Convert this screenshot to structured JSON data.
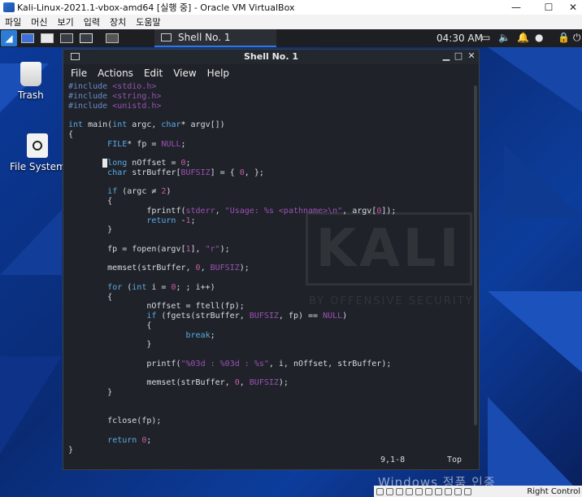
{
  "host": {
    "title": "Kali-Linux-2021.1-vbox-amd64 [실행 중] - Oracle VM VirtualBox",
    "menu": [
      "파일",
      "머신",
      "보기",
      "입력",
      "장치",
      "도움말"
    ],
    "status_right": "Right Control"
  },
  "panel": {
    "task_label": "Shell No. 1",
    "clock": "04:30 AM"
  },
  "desktop": {
    "icons": [
      "Trash",
      "File System"
    ],
    "watermark": "Windows 정품 인증"
  },
  "terminal": {
    "title": "Shell No. 1",
    "menu": [
      "File",
      "Actions",
      "Edit",
      "View",
      "Help"
    ],
    "status_pos": "9,1-8",
    "status_pct": "Top",
    "bg_logo": "KALI",
    "bg_logo_sub": "BY OFFENSIVE SECURITY",
    "code_lines": [
      "#include <stdio.h>",
      "#include <string.h>",
      "#include <unistd.h>",
      "",
      "int main(int argc, char* argv[])",
      "{",
      "        FILE* fp = NULL;",
      "",
      "        long nOffset = 0;",
      "        char strBuffer[BUFSIZ] = { 0, };",
      "",
      "        if (argc ≠ 2)",
      "        {",
      "                fprintf(stderr, \"Usage: %s <pathname>\\n\", argv[0]);",
      "                return -1;",
      "        }",
      "",
      "        fp = fopen(argv[1], \"r\");",
      "",
      "        memset(strBuffer, 0, BUFSIZ);",
      "",
      "        for (int i = 0; ; i++)",
      "        {",
      "                nOffset = ftell(fp);",
      "                if (fgets(strBuffer, BUFSIZ, fp) == NULL)",
      "                {",
      "                        break;",
      "                }",
      "",
      "                printf(\"%03d : %03d : %s\", i, nOffset, strBuffer);",
      "",
      "                memset(strBuffer, 0, BUFSIZ);",
      "        }",
      "",
      "",
      "        fclose(fp);",
      "",
      "        return 0;",
      "}"
    ]
  }
}
